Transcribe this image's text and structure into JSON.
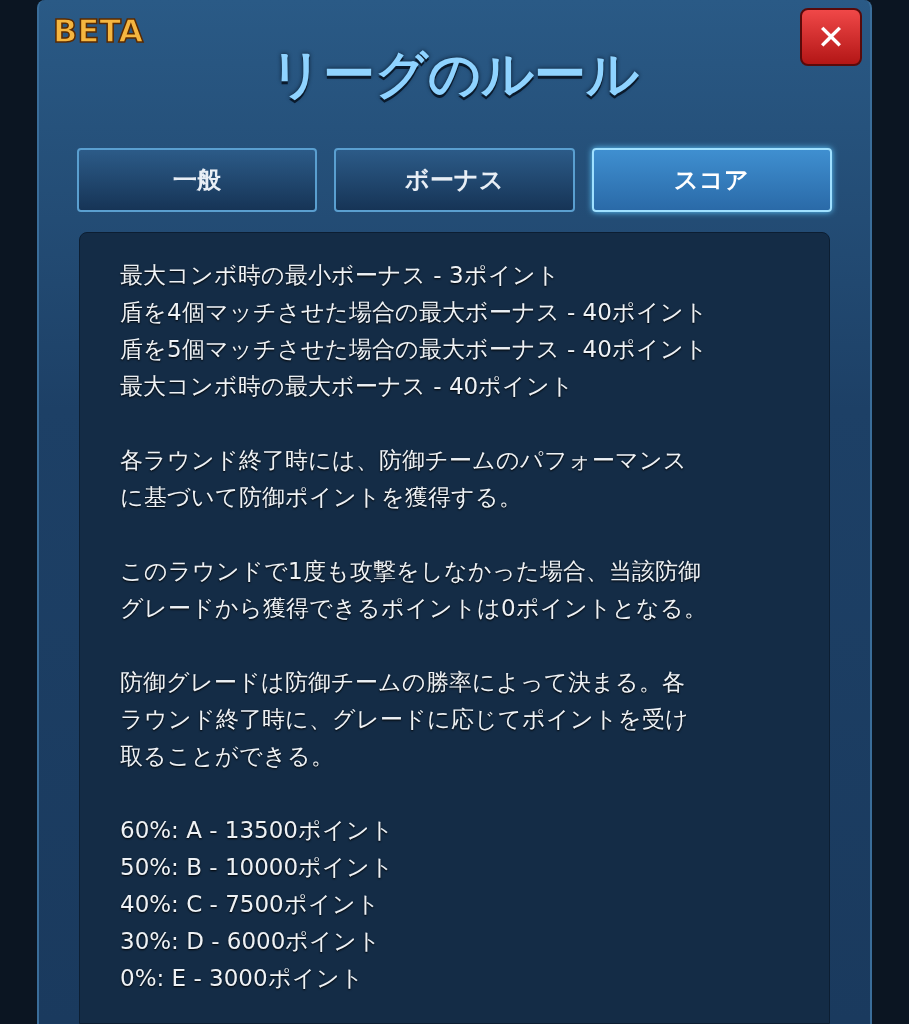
{
  "badge": "BETA",
  "title": "リーグのルール",
  "close": "✕",
  "tabs": [
    {
      "label": "一般",
      "selected": false
    },
    {
      "label": "ボーナス",
      "selected": false
    },
    {
      "label": "スコア",
      "selected": true
    }
  ],
  "paragraphs": [
    {
      "lines": [
        "最大コンボ時の最小ボーナス - 3ポイント",
        "盾を4個マッチさせた場合の最大ボーナス - 40ポイント",
        "盾を5個マッチさせた場合の最大ボーナス - 40ポイント",
        "最大コンボ時の最大ボーナス - 40ポイント"
      ]
    },
    {
      "lines": [
        "各ラウンド終了時には、防御チームのパフォーマンス",
        "に基づいて防御ポイントを獲得する。"
      ]
    },
    {
      "lines": [
        "このラウンドで1度も攻撃をしなかった場合、当該防御",
        "グレードから獲得できるポイントは0ポイントとなる。"
      ]
    },
    {
      "lines": [
        "防御グレードは防御チームの勝率によって決まる。各",
        "ラウンド終了時に、グレードに応じてポイントを受け",
        "取ることができる。"
      ]
    },
    {
      "lines": [
        "60%: A - 13500ポイント",
        "50%: B - 10000ポイント",
        "40%: C - 7500ポイント",
        "30%: D - 6000ポイント",
        "0%: E - 3000ポイント"
      ]
    }
  ]
}
